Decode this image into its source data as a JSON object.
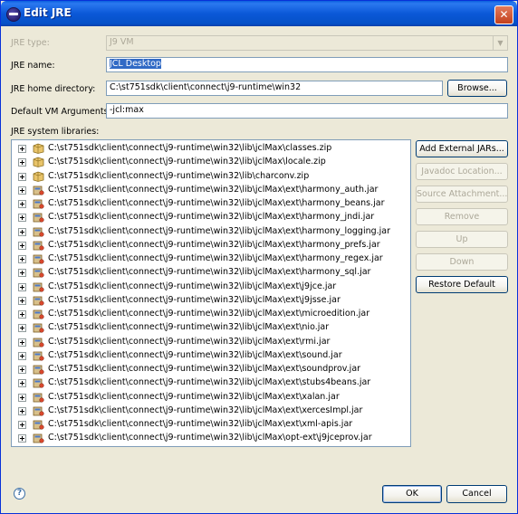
{
  "window": {
    "title": "Edit JRE",
    "close_label": "✕"
  },
  "form": {
    "jre_type_label": "JRE type:",
    "jre_type_value": "J9 VM",
    "jre_name_label": "JRE name:",
    "jre_name_value": "JCL Desktop",
    "home_dir_label": "JRE home directory:",
    "home_dir_value": "C:\\st751sdk\\client\\connect\\j9-runtime\\win32",
    "browse_label": "Browse...",
    "vm_args_label": "Default VM Arguments:",
    "vm_args_value": "-jcl:max",
    "libraries_label": "JRE system libraries:"
  },
  "libraries": [
    "C:\\st751sdk\\client\\connect\\j9-runtime\\win32\\lib\\jclMax\\classes.zip",
    "C:\\st751sdk\\client\\connect\\j9-runtime\\win32\\lib\\jclMax\\locale.zip",
    "C:\\st751sdk\\client\\connect\\j9-runtime\\win32\\lib\\charconv.zip",
    "C:\\st751sdk\\client\\connect\\j9-runtime\\win32\\lib\\jclMax\\ext\\harmony_auth.jar",
    "C:\\st751sdk\\client\\connect\\j9-runtime\\win32\\lib\\jclMax\\ext\\harmony_beans.jar",
    "C:\\st751sdk\\client\\connect\\j9-runtime\\win32\\lib\\jclMax\\ext\\harmony_jndi.jar",
    "C:\\st751sdk\\client\\connect\\j9-runtime\\win32\\lib\\jclMax\\ext\\harmony_logging.jar",
    "C:\\st751sdk\\client\\connect\\j9-runtime\\win32\\lib\\jclMax\\ext\\harmony_prefs.jar",
    "C:\\st751sdk\\client\\connect\\j9-runtime\\win32\\lib\\jclMax\\ext\\harmony_regex.jar",
    "C:\\st751sdk\\client\\connect\\j9-runtime\\win32\\lib\\jclMax\\ext\\harmony_sql.jar",
    "C:\\st751sdk\\client\\connect\\j9-runtime\\win32\\lib\\jclMax\\ext\\j9jce.jar",
    "C:\\st751sdk\\client\\connect\\j9-runtime\\win32\\lib\\jclMax\\ext\\j9jsse.jar",
    "C:\\st751sdk\\client\\connect\\j9-runtime\\win32\\lib\\jclMax\\ext\\microedition.jar",
    "C:\\st751sdk\\client\\connect\\j9-runtime\\win32\\lib\\jclMax\\ext\\nio.jar",
    "C:\\st751sdk\\client\\connect\\j9-runtime\\win32\\lib\\jclMax\\ext\\rmi.jar",
    "C:\\st751sdk\\client\\connect\\j9-runtime\\win32\\lib\\jclMax\\ext\\sound.jar",
    "C:\\st751sdk\\client\\connect\\j9-runtime\\win32\\lib\\jclMax\\ext\\soundprov.jar",
    "C:\\st751sdk\\client\\connect\\j9-runtime\\win32\\lib\\jclMax\\ext\\stubs4beans.jar",
    "C:\\st751sdk\\client\\connect\\j9-runtime\\win32\\lib\\jclMax\\ext\\xalan.jar",
    "C:\\st751sdk\\client\\connect\\j9-runtime\\win32\\lib\\jclMax\\ext\\xercesImpl.jar",
    "C:\\st751sdk\\client\\connect\\j9-runtime\\win32\\lib\\jclMax\\ext\\xml-apis.jar",
    "C:\\st751sdk\\client\\connect\\j9-runtime\\win32\\lib\\jclMax\\opt-ext\\j9jceprov.jar"
  ],
  "side_buttons": {
    "add_external": "Add External JARs...",
    "javadoc": "Javadoc Location...",
    "source": "Source Attachment...",
    "remove": "Remove",
    "up": "Up",
    "down": "Down",
    "restore": "Restore Default"
  },
  "footer": {
    "help_icon": "?",
    "ok_label": "OK",
    "cancel_label": "Cancel"
  }
}
